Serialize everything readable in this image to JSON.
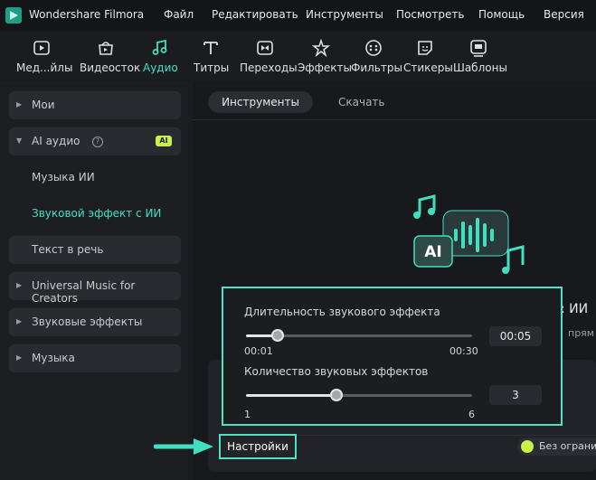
{
  "app": {
    "name": "Wondershare Filmora"
  },
  "menu": [
    "Файл",
    "Редактировать",
    "Инструменты",
    "Посмотреть",
    "Помощь",
    "Версия"
  ],
  "toolbar": {
    "items": [
      {
        "label": "Мед...йлы",
        "icon": "media-icon"
      },
      {
        "label": "Видеосток",
        "icon": "stock-video-icon"
      },
      {
        "label": "Аудио",
        "icon": "music-note-icon",
        "active": true
      },
      {
        "label": "Титры",
        "icon": "text-icon"
      },
      {
        "label": "Переходы",
        "icon": "transition-icon"
      },
      {
        "label": "Эффекты",
        "icon": "effects-icon"
      },
      {
        "label": "Фильтры",
        "icon": "filter-icon"
      },
      {
        "label": "Стикеры",
        "icon": "sticker-icon"
      },
      {
        "label": "Шаблоны",
        "icon": "template-icon"
      }
    ]
  },
  "sidebar": {
    "mine": "Мои",
    "ai_audio": "AI аудио",
    "ai_badge": "AI",
    "ai_music": "Музыка ИИ",
    "ai_sfx": "Звуковой эффект с ИИ",
    "tts": "Текст в речь",
    "universal": "Universal Music for Creators",
    "sfx": "Звуковые эффекты",
    "music": "Музыка"
  },
  "tabs": {
    "tools": "Инструменты",
    "download": "Скачать"
  },
  "background": {
    "title_fragment": ": ИИ",
    "sub_fragment": "прям"
  },
  "popup": {
    "duration_label": "Длительность звукового эффекта",
    "duration_min": "00:01",
    "duration_max": "00:30",
    "duration_value": "00:05",
    "duration_fraction": 0.138,
    "count_label": "Количество звуковых эффектов",
    "count_min": "1",
    "count_max": "6",
    "count_value": "3",
    "count_fraction": 0.4
  },
  "settings_button": "Настройки",
  "quota_text": "Без огранич",
  "colors": {
    "accent": "#3fe0bf",
    "highlight": "#4be3c3",
    "ai_badge": "#c8f24b"
  }
}
